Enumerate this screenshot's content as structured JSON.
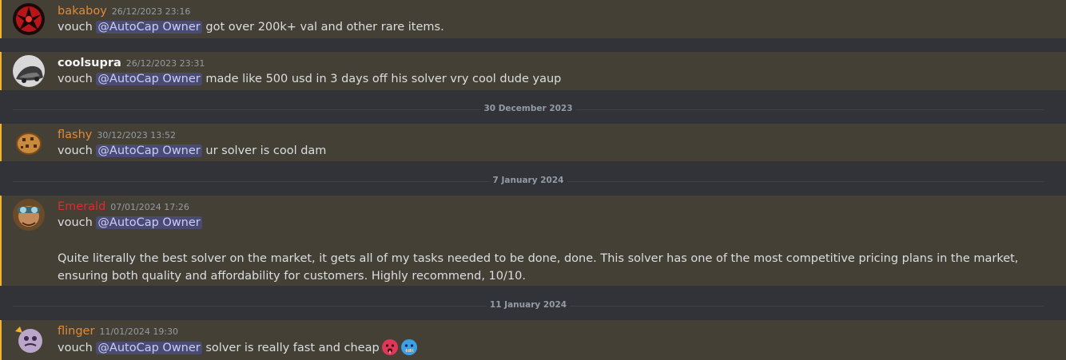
{
  "messages": [
    {
      "username": "bakaboy",
      "timestamp": "26/12/2023 23:16",
      "prefix": "vouch ",
      "mention": "@AutoCap Owner",
      "text": " got over 200k+ val and other rare items."
    },
    {
      "username": "coolsupra",
      "timestamp": "26/12/2023 23:31",
      "prefix": "vouch ",
      "mention": "@AutoCap Owner",
      "text": " made like 500 usd in 3 days off his solver vry cool dude yaup"
    },
    {
      "username": "flashy",
      "timestamp": "30/12/2023 13:52",
      "prefix": "vouch ",
      "mention": "@AutoCap Owner",
      "text": " ur solver is cool dam"
    },
    {
      "username": "Emerald",
      "timestamp": "07/01/2024 17:26",
      "prefix": "vouch ",
      "mention": "@AutoCap Owner",
      "text": "",
      "paragraph": "Quite literally the best solver on the market, it gets all of my tasks needed to be done, done. This solver has one of the most competitive pricing plans in the market, ensuring both quality and affordability for customers. Highly recommend, 10/10."
    },
    {
      "username": "flinger",
      "timestamp": "11/01/2024 19:30",
      "prefix": "vouch ",
      "mention": "@AutoCap Owner",
      "text": " solver is really fast and cheap",
      "emojis": [
        "hot-face-emoji",
        "cold-face-emoji"
      ]
    }
  ],
  "dividers": [
    "30 December 2023",
    "7 January 2024",
    "11 January 2024"
  ],
  "colors": {
    "background": "#313338",
    "highlight": "#444035",
    "highlight_bar": "#f0b232",
    "username_orange": "#e08a3a",
    "username_white": "#f2f3f5",
    "username_red": "#e3282e",
    "mention_bg": "#3c4270",
    "mention_text": "#c9cdfb"
  }
}
